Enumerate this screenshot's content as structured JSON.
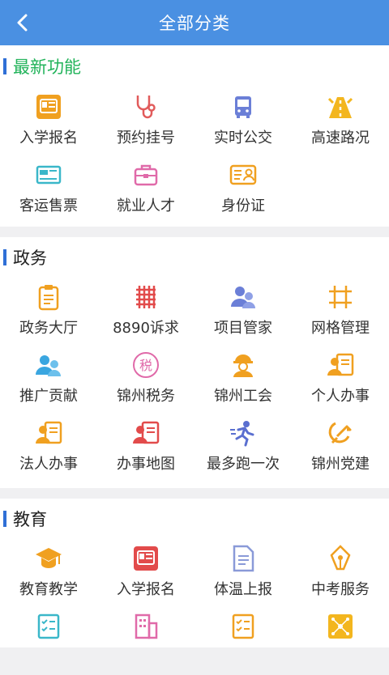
{
  "header": {
    "title": "全部分类"
  },
  "sections": [
    {
      "title": "最新功能",
      "items": [
        {
          "label": "入学报名",
          "icon": "id-card-icon"
        },
        {
          "label": "预约挂号",
          "icon": "stethoscope-icon"
        },
        {
          "label": "实时公交",
          "icon": "bus-icon"
        },
        {
          "label": "高速路况",
          "icon": "highway-icon"
        },
        {
          "label": "客运售票",
          "icon": "ticket-icon"
        },
        {
          "label": "就业人才",
          "icon": "briefcase-icon"
        },
        {
          "label": "身份证",
          "icon": "identity-card-icon"
        }
      ]
    },
    {
      "title": "政务",
      "items": [
        {
          "label": "政务大厅",
          "icon": "clipboard-icon"
        },
        {
          "label": "8890诉求",
          "icon": "hash-grid-icon"
        },
        {
          "label": "项目管家",
          "icon": "users-icon"
        },
        {
          "label": "网格管理",
          "icon": "frame-icon"
        },
        {
          "label": "推广贡献",
          "icon": "people-icon"
        },
        {
          "label": "锦州税务",
          "icon": "tax-icon"
        },
        {
          "label": "锦州工会",
          "icon": "worker-icon"
        },
        {
          "label": "个人办事",
          "icon": "person-card-icon"
        },
        {
          "label": "法人办事",
          "icon": "legal-person-icon"
        },
        {
          "label": "办事地图",
          "icon": "map-person-icon"
        },
        {
          "label": "最多跑一次",
          "icon": "runner-icon"
        },
        {
          "label": "锦州党建",
          "icon": "party-emblem-icon"
        }
      ]
    },
    {
      "title": "教育",
      "items": [
        {
          "label": "教育教学",
          "icon": "graduation-cap-icon"
        },
        {
          "label": "入学报名",
          "icon": "id-card-icon"
        },
        {
          "label": "体温上报",
          "icon": "document-icon"
        },
        {
          "label": "中考服务",
          "icon": "pen-icon"
        },
        {
          "label": "",
          "icon": "checklist-icon"
        },
        {
          "label": "",
          "icon": "building-icon"
        },
        {
          "label": "",
          "icon": "checklist-icon"
        },
        {
          "label": "",
          "icon": "network-icon"
        }
      ]
    }
  ],
  "colors": {
    "header": "#4a90e2",
    "accent_bar": "#2f6fd6",
    "new_title": "#21b35a"
  }
}
